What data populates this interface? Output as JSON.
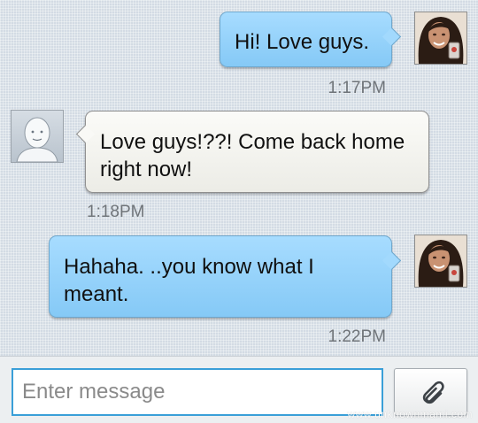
{
  "messages": [
    {
      "direction": "sent",
      "text": "Hi! Love guys.",
      "time": "1:17PM",
      "avatar": "user-photo"
    },
    {
      "direction": "received",
      "text": "Love guys!??! Come back home right now!",
      "time": "1:18PM",
      "avatar": "default-contact-icon"
    },
    {
      "direction": "sent",
      "text": "Hahaha. ..you know what I meant.",
      "time": "1:22PM",
      "avatar": "user-photo"
    }
  ],
  "composer": {
    "placeholder": "Enter message",
    "value": "",
    "attach_icon": "paperclip-icon"
  },
  "watermark": "www.unknownmami.com",
  "colors": {
    "sent_bubble": "#9dd6fc",
    "received_bubble": "#f7f7f3",
    "input_border": "#3a9fd8",
    "background": "#d3dbe4"
  }
}
